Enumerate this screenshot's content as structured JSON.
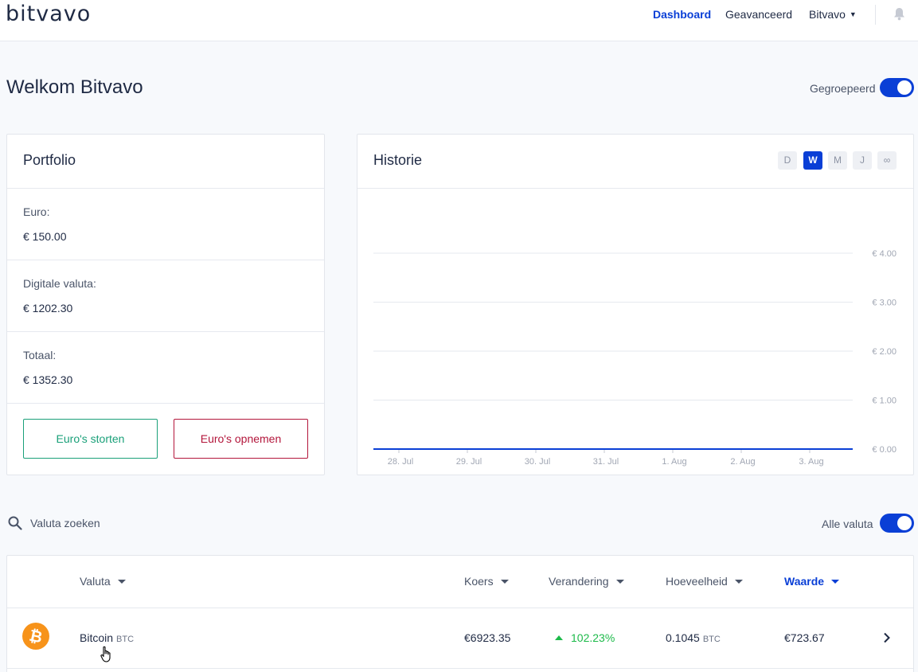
{
  "header": {
    "logo": "bitvavo",
    "nav": [
      {
        "label": "Dashboard",
        "active": true
      },
      {
        "label": "Geavanceerd",
        "active": false
      },
      {
        "label": "Bitvavo",
        "active": false
      }
    ],
    "bell_icon": "bell-icon"
  },
  "welcome": {
    "title": "Welkom Bitvavo",
    "grouped_label": "Gegroepeerd",
    "grouped_on": true
  },
  "portfolio": {
    "title": "Portfolio",
    "rows": [
      {
        "label": "Euro:",
        "value": "€ 150.00"
      },
      {
        "label": "Digitale valuta:",
        "value": "€ 1202.30"
      },
      {
        "label": "Totaal:",
        "value": "€ 1352.30"
      }
    ],
    "deposit_label": "Euro's storten",
    "withdraw_label": "Euro's opnemen"
  },
  "history": {
    "title": "Historie",
    "ranges": [
      {
        "label": "D",
        "active": false
      },
      {
        "label": "W",
        "active": true
      },
      {
        "label": "M",
        "active": false
      },
      {
        "label": "J",
        "active": false
      },
      {
        "label": "∞",
        "active": false
      }
    ]
  },
  "chart_data": {
    "type": "line",
    "x": [
      "28. Jul",
      "29. Jul",
      "30. Jul",
      "31. Jul",
      "1. Aug",
      "2. Aug",
      "3. Aug"
    ],
    "series": [
      {
        "values": [
          0,
          0,
          0,
          0,
          0,
          0,
          0
        ]
      }
    ],
    "yticks": [
      "€ 0.00",
      "€ 1.00",
      "€ 2.00",
      "€ 3.00",
      "€ 4.00"
    ],
    "ylim": [
      0,
      4
    ],
    "grid": true,
    "color": "#0a3fd6"
  },
  "search": {
    "placeholder": "Valuta zoeken",
    "all_label": "Alle valuta",
    "all_on": true
  },
  "table": {
    "headers": {
      "currency": "Valuta",
      "rate": "Koers",
      "change": "Verandering",
      "amount": "Hoeveelheid",
      "value": "Waarde"
    },
    "rows": [
      {
        "name": "Bitcoin",
        "symbol": "BTC",
        "rate": "€6923.35",
        "change": "102.23%",
        "amount": "0.1045",
        "amount_symbol": "BTC",
        "value": "€723.67",
        "icon": "bitcoin-icon",
        "icon_color": "#f7931a"
      }
    ]
  }
}
